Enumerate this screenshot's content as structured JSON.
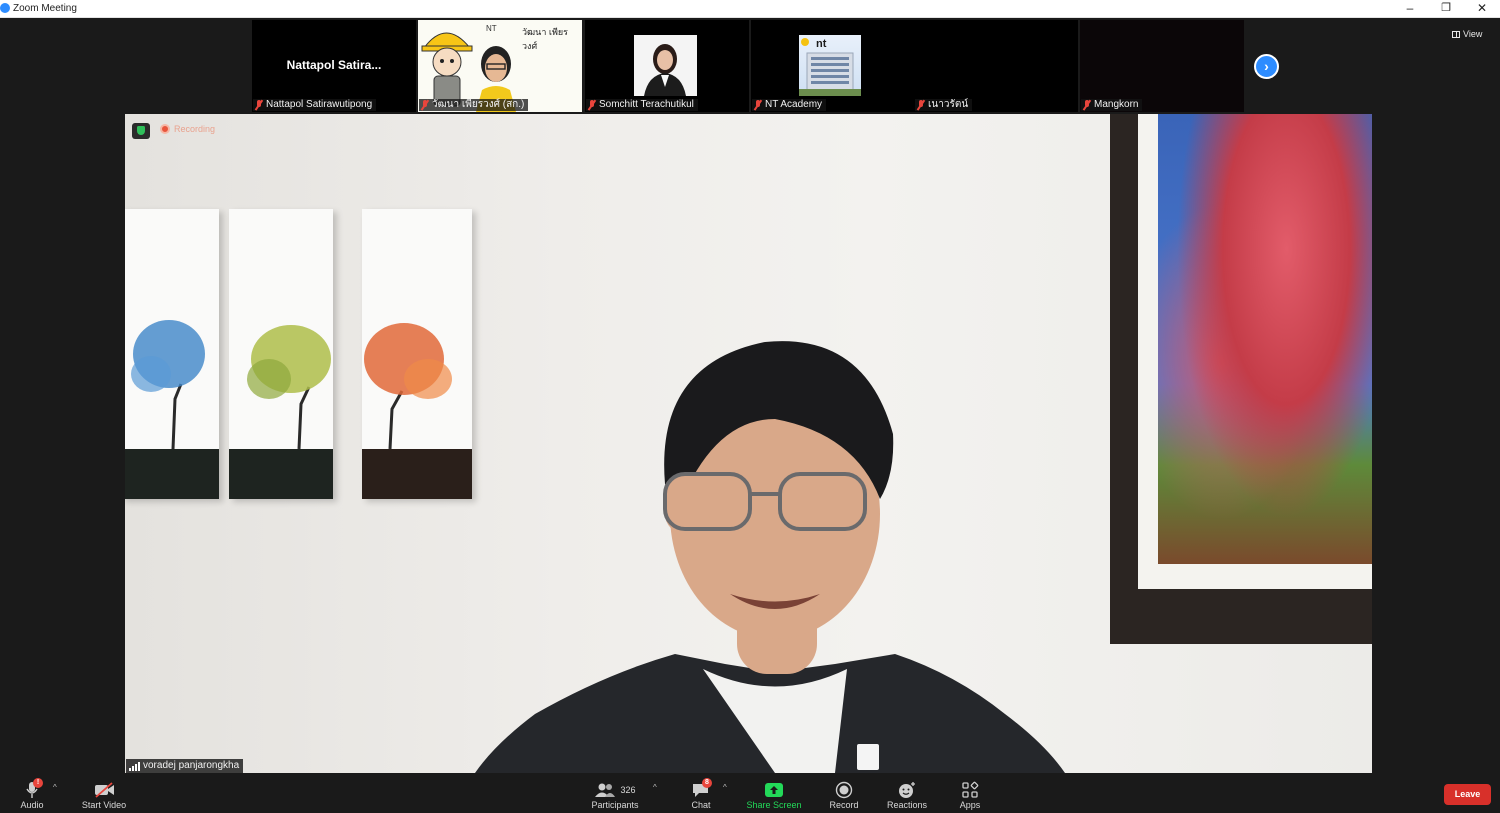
{
  "window": {
    "title": "Zoom Meeting",
    "minimize_glyph": "–",
    "restore_glyph": "❐",
    "close_glyph": "✕"
  },
  "view_button": {
    "label": "View",
    "icon": "grid-icon"
  },
  "thumbnails": [
    {
      "name": "Nattapol Satirawutipong",
      "display_name": "Nattapol  Satira...",
      "video": false,
      "muted": true
    },
    {
      "name": "วัฒนา เพียรวงศ์ (สก.)",
      "video": true,
      "muted": true,
      "overlay_text": "วัฒนา เพียรวงศ์",
      "overlay_badge": "NT"
    },
    {
      "name": "Somchitt Terachutikul",
      "video": true,
      "muted": true
    },
    {
      "name": "NT Academy",
      "video": true,
      "muted": true,
      "logo_text": "nt"
    },
    {
      "name": "เนาวรัตน์",
      "video": false,
      "muted": true
    },
    {
      "name": "Mangkorn",
      "video": false,
      "muted": true
    }
  ],
  "next_page_glyph": "›",
  "main_video": {
    "speaker_name": "voradej panjarongkha",
    "recording_label": "Recording",
    "security_icon": "shield-icon"
  },
  "toolbar": {
    "audio": {
      "label": "Audio",
      "badge": "!"
    },
    "video": {
      "label": "Start Video"
    },
    "participants": {
      "label": "Participants",
      "count": "326"
    },
    "chat": {
      "label": "Chat",
      "badge": "8"
    },
    "share": {
      "label": "Share Screen",
      "color": "#23d959"
    },
    "record": {
      "label": "Record"
    },
    "reactions": {
      "label": "Reactions"
    },
    "apps": {
      "label": "Apps"
    },
    "leave": {
      "label": "Leave",
      "color": "#d8302a"
    },
    "caret_glyph": "^"
  }
}
